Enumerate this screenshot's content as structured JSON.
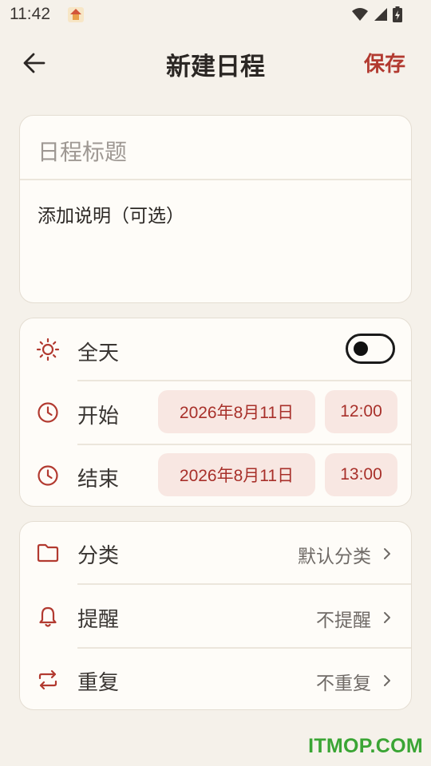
{
  "status_bar": {
    "time": "11:42",
    "notification_icon": "home-notification-icon",
    "icons": [
      "wifi-icon",
      "signal-icon",
      "battery-icon"
    ]
  },
  "app_bar": {
    "title": "新建日程",
    "save_label": "保存",
    "back_icon": "arrow-left-icon"
  },
  "event": {
    "title_placeholder": "日程标题",
    "description_placeholder": "添加说明（可选）"
  },
  "time_section": {
    "all_day": {
      "label": "全天",
      "icon": "sun-icon",
      "enabled": false
    },
    "start": {
      "label": "开始",
      "icon": "clock-icon",
      "date": "2026年8月11日",
      "time": "12:00"
    },
    "end": {
      "label": "结束",
      "icon": "clock-icon",
      "date": "2026年8月11日",
      "time": "13:00"
    }
  },
  "options_section": [
    {
      "label": "分类",
      "icon": "folder-icon",
      "value": "默认分类"
    },
    {
      "label": "提醒",
      "icon": "bell-icon",
      "value": "不提醒"
    },
    {
      "label": "重复",
      "icon": "repeat-icon",
      "value": "不重复"
    }
  ],
  "watermark": "ITMOP.COM",
  "colors": {
    "accent": "#b23a30",
    "chip_bg": "#f8e7e2",
    "background": "#f5f1ea",
    "card": "#fefcf8"
  }
}
